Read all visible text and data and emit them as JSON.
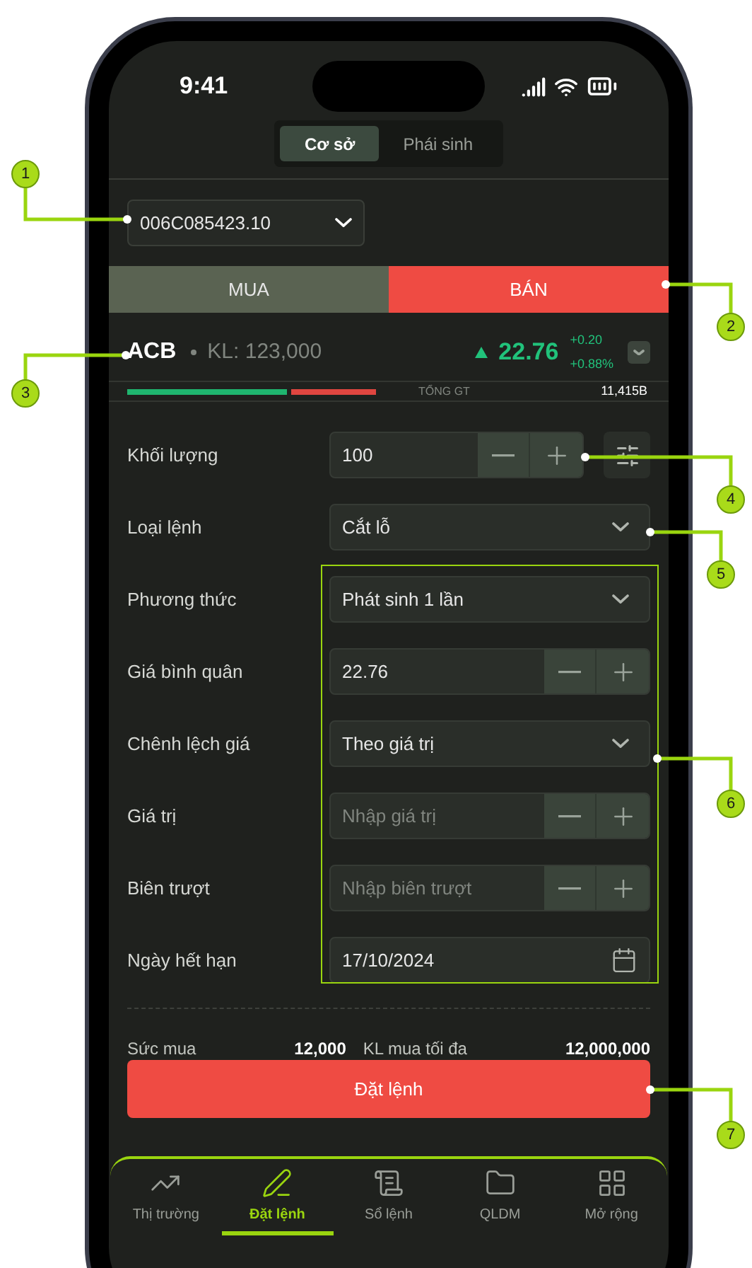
{
  "status_bar": {
    "time": "9:41"
  },
  "market_tabs": [
    {
      "label": "Cơ sở",
      "selected": true
    },
    {
      "label": "Phái sinh",
      "selected": false
    }
  ],
  "account": {
    "value": "006C085423.10"
  },
  "side_tabs": [
    {
      "label": "MUA",
      "selected": false
    },
    {
      "label": "BÁN",
      "selected": true
    }
  ],
  "stock": {
    "symbol": "ACB",
    "volume": "KL: 123,000",
    "price": "22.76",
    "change": "+0.20",
    "change_pct": "+0.88%"
  },
  "summary": {
    "label": "TỔNG GT",
    "value": "11,415B",
    "level": 0.66
  },
  "form": [
    {
      "kind": "stepper",
      "label": "Khối lượng",
      "value": "100",
      "settings": true
    },
    {
      "kind": "select",
      "label": "Loại lệnh",
      "value": "Cắt lỗ"
    },
    {
      "kind": "select",
      "label": "Phương thức",
      "value": "Phát sinh 1 lần"
    },
    {
      "kind": "stepper",
      "label": "Giá bình quân",
      "value": "22.76"
    },
    {
      "kind": "select",
      "label": "Chênh lệch giá",
      "value": "Theo giá trị"
    },
    {
      "kind": "stepper",
      "label": "Giá trị",
      "placeholder": "Nhập giá trị"
    },
    {
      "kind": "stepper",
      "label": "Biên trượt",
      "placeholder": "Nhập biên trượt"
    },
    {
      "kind": "date",
      "label": "Ngày hết hạn",
      "value": "17/10/2024"
    }
  ],
  "buying_power": {
    "label": "Sức mua",
    "value": "12,000"
  },
  "max_volume": {
    "label": "KL mua tối đa",
    "value": "12,000,000"
  },
  "submit": "Đặt lệnh",
  "nav": [
    {
      "label": "Thị trường",
      "selected": false
    },
    {
      "label": "Đặt lệnh",
      "selected": true
    },
    {
      "label": "Sổ lệnh",
      "selected": false
    },
    {
      "label": "QLDM",
      "selected": false
    },
    {
      "label": "Mở rộng",
      "selected": false
    }
  ],
  "callouts": [
    "1",
    "2",
    "3",
    "4",
    "5",
    "6",
    "7"
  ]
}
